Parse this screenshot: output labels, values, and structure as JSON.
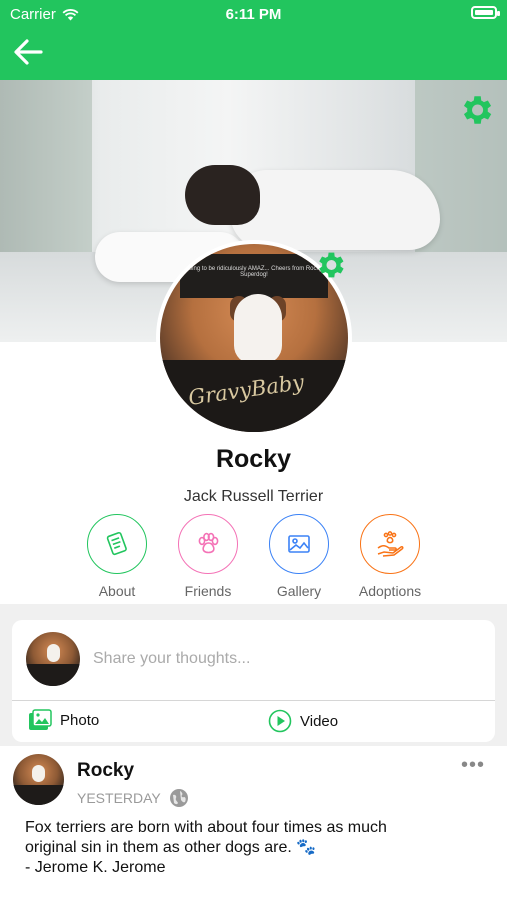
{
  "status_bar": {
    "carrier": "Carrier",
    "time": "6:11 PM"
  },
  "nav": {
    "back_icon": "arrow-left-icon"
  },
  "profile": {
    "name": "Rocky",
    "breed": "Jack Russell Terrier",
    "avatar_sign_text": "going to be ridiculously AMAZ... Cheers from Rocky Superdog!",
    "avatar_logo_text": "GravyBaby"
  },
  "actions": [
    {
      "label": "About",
      "icon": "document-icon",
      "color": "#22c55e"
    },
    {
      "label": "Friends",
      "icon": "paw-icon",
      "color": "#f472b6"
    },
    {
      "label": "Gallery",
      "icon": "image-icon",
      "color": "#3b82f6"
    },
    {
      "label": "Adoptions",
      "icon": "hand-paw-icon",
      "color": "#f97316"
    }
  ],
  "composer": {
    "placeholder": "Share your thoughts...",
    "photo_label": "Photo",
    "video_label": "Video"
  },
  "post": {
    "author": "Rocky",
    "time": "YESTERDAY",
    "text": "Fox terriers are born with about four times as much\noriginal sin in them as other dogs are. 🐾\n- Jerome K. Jerome"
  },
  "colors": {
    "brand": "#22c55e"
  }
}
